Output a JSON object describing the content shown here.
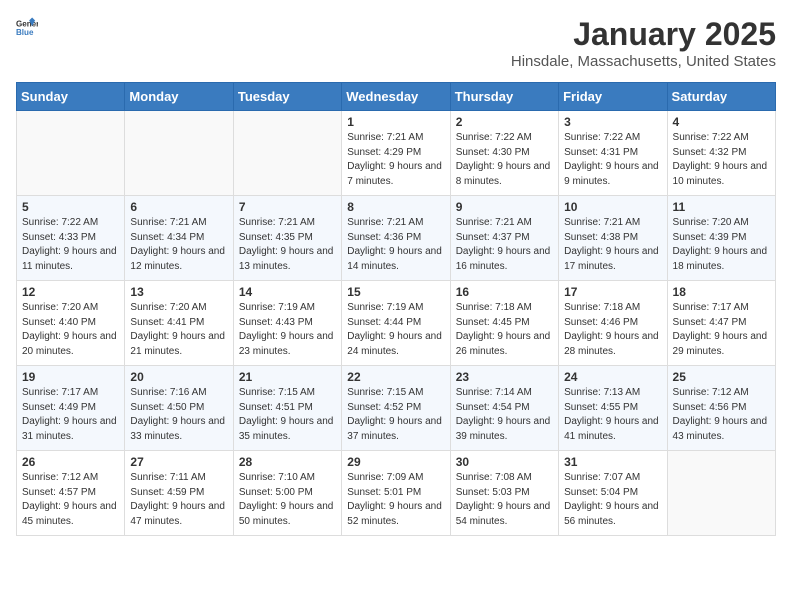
{
  "logo": {
    "general": "General",
    "blue": "Blue"
  },
  "header": {
    "month": "January 2025",
    "location": "Hinsdale, Massachusetts, United States"
  },
  "weekdays": [
    "Sunday",
    "Monday",
    "Tuesday",
    "Wednesday",
    "Thursday",
    "Friday",
    "Saturday"
  ],
  "weeks": [
    [
      {
        "day": "",
        "sunrise": "",
        "sunset": "",
        "daylight": ""
      },
      {
        "day": "",
        "sunrise": "",
        "sunset": "",
        "daylight": ""
      },
      {
        "day": "",
        "sunrise": "",
        "sunset": "",
        "daylight": ""
      },
      {
        "day": "1",
        "sunrise": "Sunrise: 7:21 AM",
        "sunset": "Sunset: 4:29 PM",
        "daylight": "Daylight: 9 hours and 7 minutes."
      },
      {
        "day": "2",
        "sunrise": "Sunrise: 7:22 AM",
        "sunset": "Sunset: 4:30 PM",
        "daylight": "Daylight: 9 hours and 8 minutes."
      },
      {
        "day": "3",
        "sunrise": "Sunrise: 7:22 AM",
        "sunset": "Sunset: 4:31 PM",
        "daylight": "Daylight: 9 hours and 9 minutes."
      },
      {
        "day": "4",
        "sunrise": "Sunrise: 7:22 AM",
        "sunset": "Sunset: 4:32 PM",
        "daylight": "Daylight: 9 hours and 10 minutes."
      }
    ],
    [
      {
        "day": "5",
        "sunrise": "Sunrise: 7:22 AM",
        "sunset": "Sunset: 4:33 PM",
        "daylight": "Daylight: 9 hours and 11 minutes."
      },
      {
        "day": "6",
        "sunrise": "Sunrise: 7:21 AM",
        "sunset": "Sunset: 4:34 PM",
        "daylight": "Daylight: 9 hours and 12 minutes."
      },
      {
        "day": "7",
        "sunrise": "Sunrise: 7:21 AM",
        "sunset": "Sunset: 4:35 PM",
        "daylight": "Daylight: 9 hours and 13 minutes."
      },
      {
        "day": "8",
        "sunrise": "Sunrise: 7:21 AM",
        "sunset": "Sunset: 4:36 PM",
        "daylight": "Daylight: 9 hours and 14 minutes."
      },
      {
        "day": "9",
        "sunrise": "Sunrise: 7:21 AM",
        "sunset": "Sunset: 4:37 PM",
        "daylight": "Daylight: 9 hours and 16 minutes."
      },
      {
        "day": "10",
        "sunrise": "Sunrise: 7:21 AM",
        "sunset": "Sunset: 4:38 PM",
        "daylight": "Daylight: 9 hours and 17 minutes."
      },
      {
        "day": "11",
        "sunrise": "Sunrise: 7:20 AM",
        "sunset": "Sunset: 4:39 PM",
        "daylight": "Daylight: 9 hours and 18 minutes."
      }
    ],
    [
      {
        "day": "12",
        "sunrise": "Sunrise: 7:20 AM",
        "sunset": "Sunset: 4:40 PM",
        "daylight": "Daylight: 9 hours and 20 minutes."
      },
      {
        "day": "13",
        "sunrise": "Sunrise: 7:20 AM",
        "sunset": "Sunset: 4:41 PM",
        "daylight": "Daylight: 9 hours and 21 minutes."
      },
      {
        "day": "14",
        "sunrise": "Sunrise: 7:19 AM",
        "sunset": "Sunset: 4:43 PM",
        "daylight": "Daylight: 9 hours and 23 minutes."
      },
      {
        "day": "15",
        "sunrise": "Sunrise: 7:19 AM",
        "sunset": "Sunset: 4:44 PM",
        "daylight": "Daylight: 9 hours and 24 minutes."
      },
      {
        "day": "16",
        "sunrise": "Sunrise: 7:18 AM",
        "sunset": "Sunset: 4:45 PM",
        "daylight": "Daylight: 9 hours and 26 minutes."
      },
      {
        "day": "17",
        "sunrise": "Sunrise: 7:18 AM",
        "sunset": "Sunset: 4:46 PM",
        "daylight": "Daylight: 9 hours and 28 minutes."
      },
      {
        "day": "18",
        "sunrise": "Sunrise: 7:17 AM",
        "sunset": "Sunset: 4:47 PM",
        "daylight": "Daylight: 9 hours and 29 minutes."
      }
    ],
    [
      {
        "day": "19",
        "sunrise": "Sunrise: 7:17 AM",
        "sunset": "Sunset: 4:49 PM",
        "daylight": "Daylight: 9 hours and 31 minutes."
      },
      {
        "day": "20",
        "sunrise": "Sunrise: 7:16 AM",
        "sunset": "Sunset: 4:50 PM",
        "daylight": "Daylight: 9 hours and 33 minutes."
      },
      {
        "day": "21",
        "sunrise": "Sunrise: 7:15 AM",
        "sunset": "Sunset: 4:51 PM",
        "daylight": "Daylight: 9 hours and 35 minutes."
      },
      {
        "day": "22",
        "sunrise": "Sunrise: 7:15 AM",
        "sunset": "Sunset: 4:52 PM",
        "daylight": "Daylight: 9 hours and 37 minutes."
      },
      {
        "day": "23",
        "sunrise": "Sunrise: 7:14 AM",
        "sunset": "Sunset: 4:54 PM",
        "daylight": "Daylight: 9 hours and 39 minutes."
      },
      {
        "day": "24",
        "sunrise": "Sunrise: 7:13 AM",
        "sunset": "Sunset: 4:55 PM",
        "daylight": "Daylight: 9 hours and 41 minutes."
      },
      {
        "day": "25",
        "sunrise": "Sunrise: 7:12 AM",
        "sunset": "Sunset: 4:56 PM",
        "daylight": "Daylight: 9 hours and 43 minutes."
      }
    ],
    [
      {
        "day": "26",
        "sunrise": "Sunrise: 7:12 AM",
        "sunset": "Sunset: 4:57 PM",
        "daylight": "Daylight: 9 hours and 45 minutes."
      },
      {
        "day": "27",
        "sunrise": "Sunrise: 7:11 AM",
        "sunset": "Sunset: 4:59 PM",
        "daylight": "Daylight: 9 hours and 47 minutes."
      },
      {
        "day": "28",
        "sunrise": "Sunrise: 7:10 AM",
        "sunset": "Sunset: 5:00 PM",
        "daylight": "Daylight: 9 hours and 50 minutes."
      },
      {
        "day": "29",
        "sunrise": "Sunrise: 7:09 AM",
        "sunset": "Sunset: 5:01 PM",
        "daylight": "Daylight: 9 hours and 52 minutes."
      },
      {
        "day": "30",
        "sunrise": "Sunrise: 7:08 AM",
        "sunset": "Sunset: 5:03 PM",
        "daylight": "Daylight: 9 hours and 54 minutes."
      },
      {
        "day": "31",
        "sunrise": "Sunrise: 7:07 AM",
        "sunset": "Sunset: 5:04 PM",
        "daylight": "Daylight: 9 hours and 56 minutes."
      },
      {
        "day": "",
        "sunrise": "",
        "sunset": "",
        "daylight": ""
      }
    ]
  ]
}
